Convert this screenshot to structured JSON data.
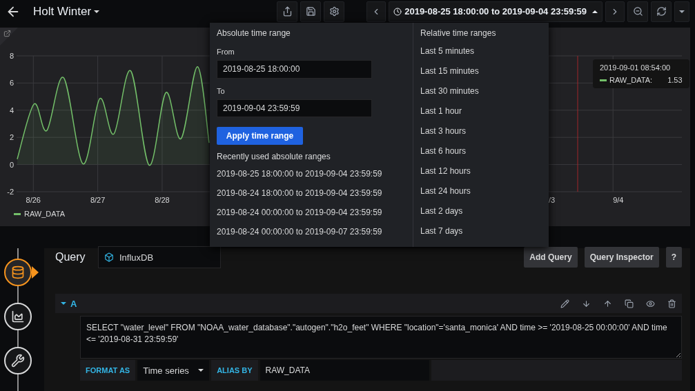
{
  "toolbar": {
    "title": "Holt Winter",
    "time_range": "2019-08-25 18:00:00 to 2019-09-04 23:59:59"
  },
  "panel": {
    "chart_data": {
      "type": "area",
      "grid": true,
      "x": [
        "2019-08-25 18:00",
        "2019-08-26 00:15",
        "2019-08-26 05:00",
        "2019-08-26 11:15",
        "2019-08-26 18:30",
        "2019-08-27 00:45",
        "2019-08-27 06:00",
        "2019-08-27 12:15",
        "2019-08-27 19:10",
        "2019-08-28 01:25",
        "2019-08-28 07:00",
        "2019-08-28 13:10",
        "2019-08-28 17:30"
      ],
      "series": [
        {
          "name": "RAW_DATA",
          "color": "#73bf69",
          "values": [
            0.4,
            4.45,
            2.5,
            6.4,
            0.05,
            4.85,
            2.25,
            6.9,
            -0.05,
            5.3,
            1.9,
            7.2,
            1.6
          ]
        }
      ],
      "xlim": [
        "2019-08-25 17:45",
        "2019-09-05 01:40"
      ],
      "xticks": [
        {
          "value": "2019-08-26 00:00",
          "label": "8/26"
        },
        {
          "value": "2019-08-27 00:00",
          "label": "8/27"
        },
        {
          "value": "2019-08-28 00:00",
          "label": "8/28"
        },
        {
          "value": "2019-09-03 00:00",
          "label": "/3"
        },
        {
          "value": "2019-09-04 00:00",
          "label": "9/4"
        }
      ],
      "yticks": [
        -2,
        0,
        2,
        4,
        6,
        8
      ],
      "ylim": [
        -2,
        8
      ],
      "ref_lines": [
        {
          "axis": "x",
          "value": "2019-09-03 10:50",
          "color": "#a0262b"
        }
      ]
    },
    "tooltip": {
      "time": "2019-09-01 08:54:00",
      "series": "RAW_DATA:",
      "value": "1.53",
      "color": "#73bf69"
    }
  },
  "time_picker": {
    "absolute_title": "Absolute time range",
    "from_label": "From",
    "from_value": "2019-08-25 18:00:00",
    "to_label": "To",
    "to_value": "2019-09-04 23:59:59",
    "apply_button": "Apply time range",
    "recent_title": "Recently used absolute ranges",
    "recent_ranges": [
      "2019-08-25 18:00:00 to 2019-09-04 23:59:59",
      "2019-08-24 18:00:00 to 2019-09-04 23:59:59",
      "2019-08-24 00:00:00 to 2019-09-04 23:59:59",
      "2019-08-24 00:00:00 to 2019-09-07 23:59:59"
    ],
    "relative_title": "Relative time ranges",
    "relative_ranges": [
      "Last 5 minutes",
      "Last 15 minutes",
      "Last 30 minutes",
      "Last 1 hour",
      "Last 3 hours",
      "Last 6 hours",
      "Last 12 hours",
      "Last 24 hours",
      "Last 2 days",
      "Last 7 days"
    ]
  },
  "query": {
    "title": "Query",
    "datasource": "InfluxDB",
    "buttons": [
      "Add Query",
      "Query Inspector",
      "?"
    ],
    "steps": [
      {
        "kind": "queries",
        "selected": true
      },
      {
        "kind": "visualization",
        "selected": false
      },
      {
        "kind": "general",
        "selected": false
      }
    ],
    "target": {
      "ref": "A",
      "expanded": true,
      "text": "SELECT \"water_level\" FROM \"NOAA_water_database\".\"autogen\".\"h2o_feet\" WHERE \"location\"='santa_monica' AND time >= '2019-08-25 00:00:00' AND time <= '2019-08-31 23:59:59'",
      "format_label": "FORMAT AS",
      "format_value": "Time series",
      "alias_label": "ALIAS BY",
      "alias_value": "RAW_DATA"
    }
  }
}
